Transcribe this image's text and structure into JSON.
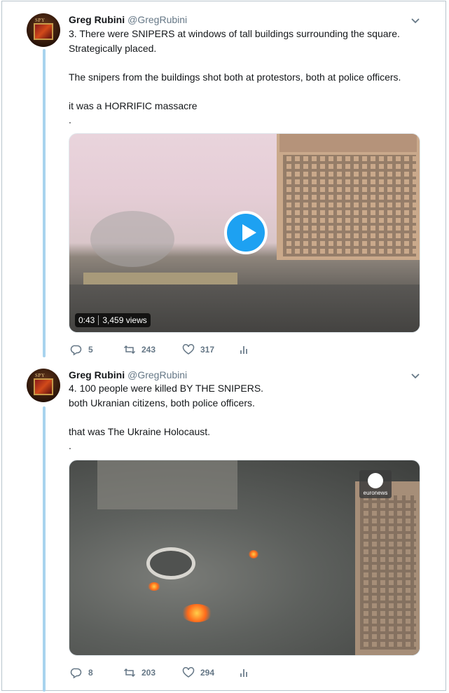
{
  "tweets": [
    {
      "name": "Greg Rubini",
      "handle": "@GregRubini",
      "avatar_text": "SPY",
      "text": "3. There were SNIPERS at windows of tall buildings surrounding the square.\nStrategically placed.\n\nThe snipers from the buildings shot both at protestors, both at police officers.\n\nit was a HORRIFIC massacre\n.",
      "media": {
        "type": "video",
        "duration": "0:43",
        "views": "3,459 views"
      },
      "actions": {
        "replies": "5",
        "retweets": "243",
        "likes": "317"
      }
    },
    {
      "name": "Greg Rubini",
      "handle": "@GregRubini",
      "avatar_text": "SPY",
      "text": "4. 100 people were killed BY THE SNIPERS.\nboth Ukranian citizens, both police officers.\n\nthat was The Ukraine Holocaust.\n.",
      "media": {
        "type": "image",
        "watermark": "euronews"
      },
      "actions": {
        "replies": "8",
        "retweets": "203",
        "likes": "294"
      }
    }
  ],
  "colors": {
    "accent": "#1da1f2",
    "thread_line": "#a8d3ee",
    "muted": "#657786"
  },
  "icons": [
    "chevron-down-icon",
    "reply-icon",
    "retweet-icon",
    "like-icon",
    "analytics-icon",
    "play-icon"
  ]
}
